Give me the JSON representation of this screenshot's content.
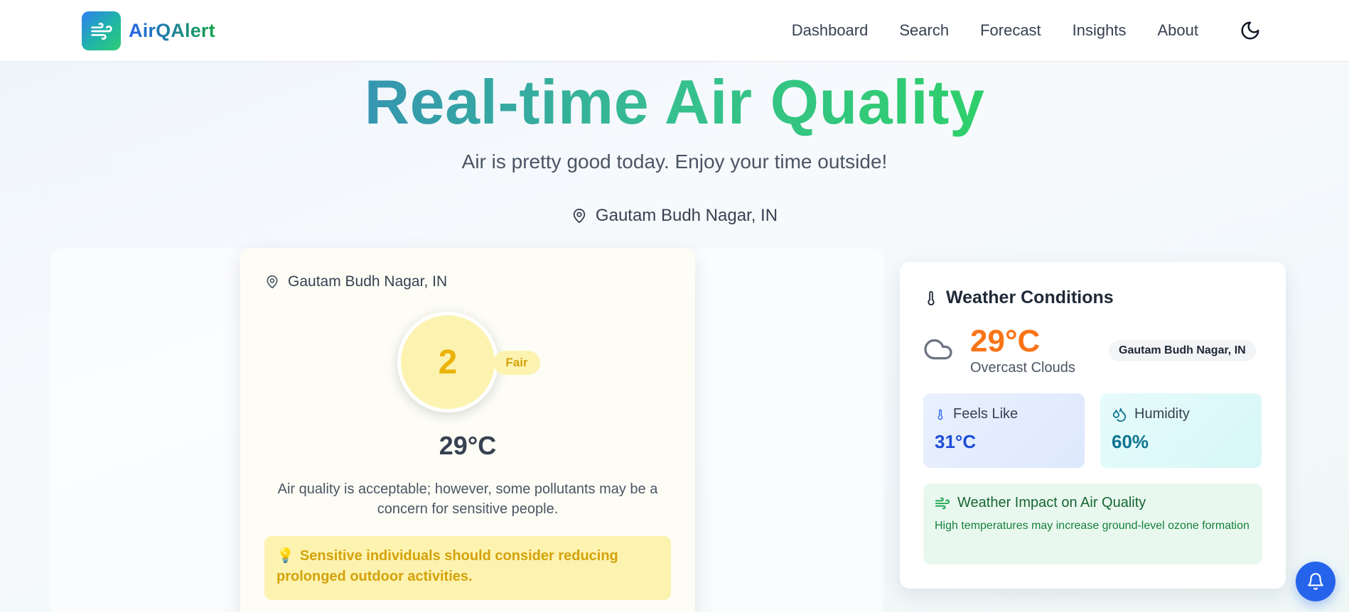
{
  "header": {
    "brand": "AirQAlert",
    "nav": [
      "Dashboard",
      "Search",
      "Forecast",
      "Insights",
      "About"
    ],
    "theme_icon": "moon-icon"
  },
  "hero": {
    "title": "Real-time Air Quality",
    "subtitle": "Air is pretty good today. Enjoy your time outside!",
    "location": "Gautam Budh Nagar, IN"
  },
  "aqi_card": {
    "location": "Gautam Budh Nagar, IN",
    "aqi_value": "2",
    "aqi_label": "Fair",
    "temperature": "29°C",
    "description": "Air quality is acceptable; however, some pollutants may be a concern for sensitive people.",
    "advice_icon": "💡",
    "advice": "Sensitive individuals should consider reducing prolonged outdoor activities.",
    "colors": {
      "accent": "#eab308",
      "bg": "#fdf3b0"
    }
  },
  "weather_card": {
    "title": "Weather Conditions",
    "temperature": "29°C",
    "condition": "Overcast Clouds",
    "location": "Gautam Budh Nagar, IN",
    "feels_like": {
      "label": "Feels Like",
      "value": "31°C"
    },
    "humidity": {
      "label": "Humidity",
      "value": "60%"
    },
    "impact": {
      "title": "Weather Impact on Air Quality",
      "text": "High temperatures may increase ground-level ozone formation"
    },
    "colors": {
      "temp": "#f97316",
      "feels": "#1d4ed8",
      "humidity": "#0e7490",
      "impact": "#166534"
    }
  },
  "fab": {
    "icon": "bell-icon",
    "color": "#2563eb"
  }
}
